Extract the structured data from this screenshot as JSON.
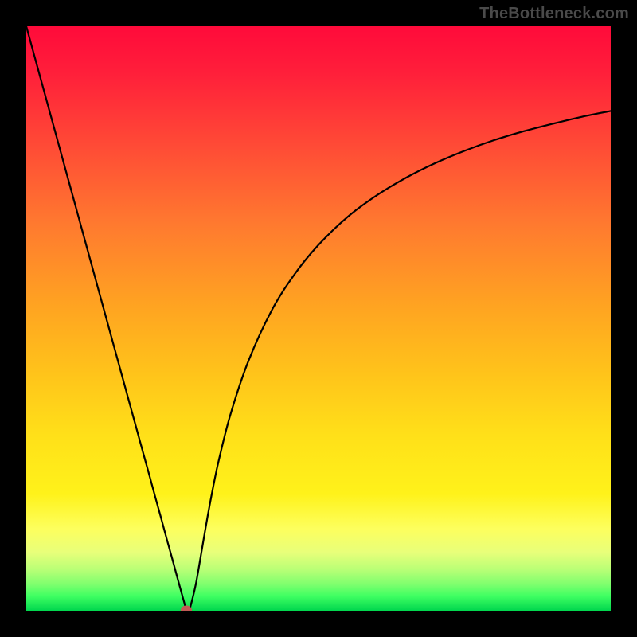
{
  "watermark": "TheBottleneck.com",
  "colors": {
    "frame": "#000000",
    "curve": "#000000",
    "marker": "#c15a55"
  },
  "chart_data": {
    "type": "line",
    "title": "",
    "xlabel": "",
    "ylabel": "",
    "xlim": [
      0,
      100
    ],
    "ylim": [
      0,
      100
    ],
    "x": [
      0,
      2,
      4,
      6,
      8,
      10,
      12,
      14,
      16,
      18,
      20,
      21,
      22,
      23,
      24,
      25,
      26,
      27,
      27.2,
      27.5,
      27.8,
      28,
      29,
      30,
      31,
      32,
      33,
      35,
      38,
      42,
      46,
      50,
      55,
      60,
      65,
      70,
      75,
      80,
      85,
      90,
      95,
      100
    ],
    "values": [
      100,
      92.7,
      85.4,
      78.1,
      70.8,
      63.5,
      56.2,
      48.9,
      41.6,
      34.3,
      27.0,
      23.4,
      19.7,
      16.1,
      12.4,
      8.8,
      5.1,
      1.5,
      0.7,
      0.0,
      0.1,
      0.4,
      4.5,
      10.2,
      16.0,
      21.3,
      26.0,
      33.8,
      42.7,
      51.4,
      57.7,
      62.6,
      67.4,
      71.1,
      74.1,
      76.6,
      78.7,
      80.5,
      82.0,
      83.3,
      84.5,
      85.5
    ],
    "marker": {
      "x": 27.4,
      "y": 0.2
    },
    "annotations": []
  }
}
